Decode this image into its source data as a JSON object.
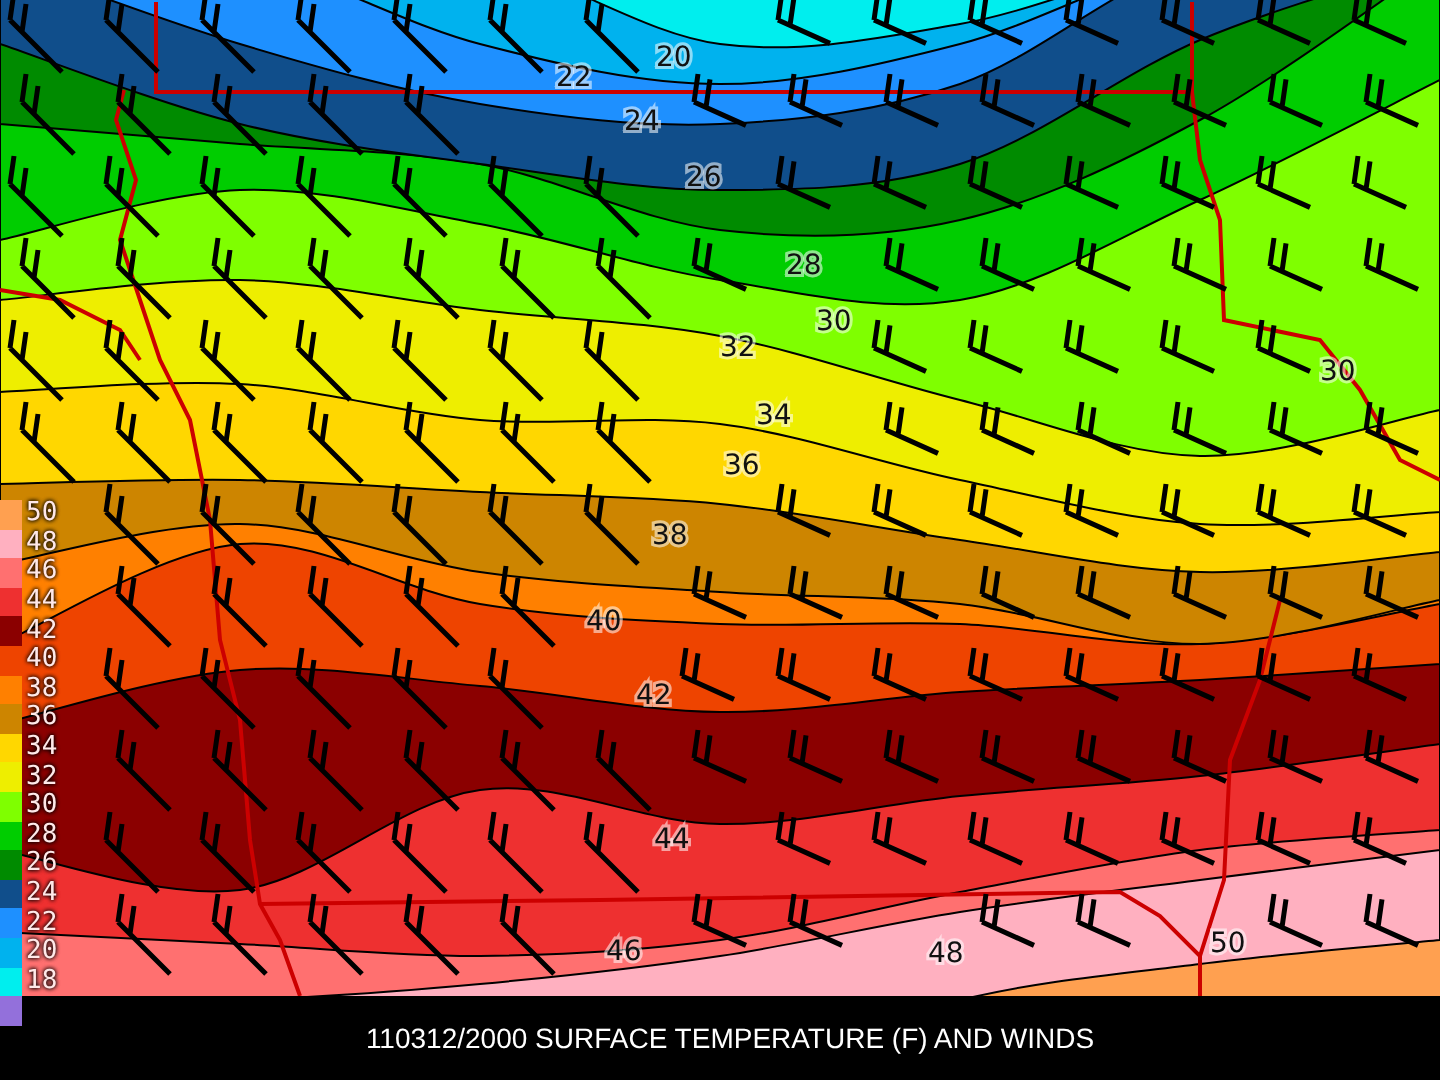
{
  "map": {
    "contour_labels": [
      "20",
      "22",
      "24",
      "26",
      "28",
      "30",
      "32",
      "34",
      "36",
      "38",
      "40",
      "42",
      "44",
      "46",
      "48",
      "50",
      "30"
    ]
  },
  "legend": {
    "items": [
      {
        "label": "50",
        "color": "#ffa050"
      },
      {
        "label": "48",
        "color": "#ffb0c0"
      },
      {
        "label": "46",
        "color": "#ff7070"
      },
      {
        "label": "44",
        "color": "#ee3030"
      },
      {
        "label": "42",
        "color": "#8b0000"
      },
      {
        "label": "40",
        "color": "#ee4400"
      },
      {
        "label": "38",
        "color": "#ff8000"
      },
      {
        "label": "36",
        "color": "#cd8500"
      },
      {
        "label": "34",
        "color": "#ffd700"
      },
      {
        "label": "32",
        "color": "#eeee00"
      },
      {
        "label": "30",
        "color": "#7fff00"
      },
      {
        "label": "28",
        "color": "#00cd00"
      },
      {
        "label": "26",
        "color": "#008b00"
      },
      {
        "label": "24",
        "color": "#104e8b"
      },
      {
        "label": "22",
        "color": "#1e90ff"
      },
      {
        "label": "20",
        "color": "#00b2ee"
      },
      {
        "label": "18",
        "color": "#00eeee"
      },
      {
        "color": "#9370db"
      }
    ]
  },
  "title": "110312/2000 SURFACE TEMPERATURE (F) AND WINDS"
}
